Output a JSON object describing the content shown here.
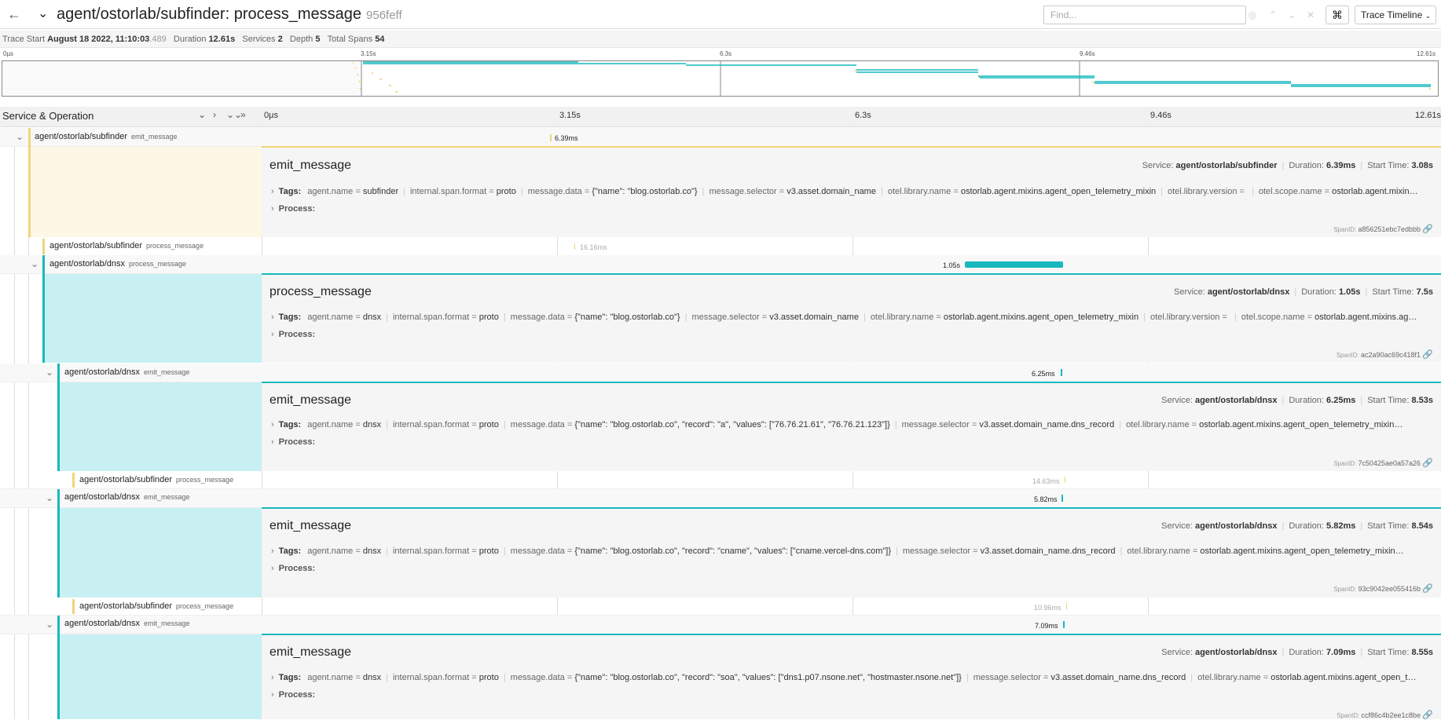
{
  "header": {
    "title": "agent/ostorlab/subfinder: process_message",
    "trace_id": "956feff",
    "find_placeholder": "Find...",
    "view_selector": "Trace Timeline"
  },
  "info": {
    "trace_start_label": "Trace Start",
    "trace_start": "August 18 2022, 11:10:03",
    "trace_start_ms": ".489",
    "duration_label": "Duration",
    "duration": "12.61s",
    "services_label": "Services",
    "services": "2",
    "depth_label": "Depth",
    "depth": "5",
    "spans_label": "Total Spans",
    "spans": "54"
  },
  "minimap": {
    "ticks": [
      "0µs",
      "3.15s",
      "6.3s",
      "9.46s",
      "12.61s"
    ]
  },
  "timeline": {
    "service_operation": "Service & Operation",
    "ticks": [
      "0µs",
      "3.15s",
      "6.3s",
      "9.46s",
      "12.61s"
    ]
  },
  "colors": {
    "subfinder": "#f0d47a",
    "dnsx": "#17b8be",
    "subfinder_bg": "#fdf8e6",
    "dnsx_bg": "#c8f0f2"
  },
  "labels": {
    "tags": "Tags:",
    "process": "Process:",
    "service": "Service:",
    "duration": "Duration:",
    "start_time": "Start Time:",
    "span_id": "SpanID:"
  },
  "spans": [
    {
      "service": "agent/ostorlab/subfinder",
      "operation": "emit_message",
      "duration": "6.39ms"
    },
    {
      "service": "agent/ostorlab/subfinder",
      "operation": "process_message",
      "duration": "16.16ms"
    },
    {
      "service": "agent/ostorlab/dnsx",
      "operation": "process_message",
      "duration": "1.05s"
    },
    {
      "service": "agent/ostorlab/dnsx",
      "operation": "emit_message",
      "duration": "6.25ms"
    },
    {
      "service": "agent/ostorlab/subfinder",
      "operation": "process_message",
      "duration": "14.63ms"
    },
    {
      "service": "agent/ostorlab/dnsx",
      "operation": "emit_message",
      "duration": "5.82ms"
    },
    {
      "service": "agent/ostorlab/subfinder",
      "operation": "process_message",
      "duration": "10.96ms"
    },
    {
      "service": "agent/ostorlab/dnsx",
      "operation": "emit_message",
      "duration": "7.09ms"
    }
  ],
  "details": [
    {
      "title": "emit_message",
      "service": "agent/ostorlab/subfinder",
      "duration": "6.39ms",
      "start": "3.08s",
      "span_id": "a856251ebc7edbbb",
      "tags": [
        {
          "k": "agent.name",
          "v": "subfinder"
        },
        {
          "k": "internal.span.format",
          "v": "proto"
        },
        {
          "k": "message.data",
          "v": "{\"name\": \"blog.ostorlab.co\"}"
        },
        {
          "k": "message.selector",
          "v": "v3.asset.domain_name"
        },
        {
          "k": "otel.library.name",
          "v": "ostorlab.agent.mixins.agent_open_telemetry_mixin"
        },
        {
          "k": "otel.library.version",
          "v": ""
        },
        {
          "k": "otel.scope.name",
          "v": "ostorlab.agent.mixin…"
        }
      ]
    },
    {
      "title": "process_message",
      "service": "agent/ostorlab/dnsx",
      "duration": "1.05s",
      "start": "7.5s",
      "span_id": "ac2a90ac69c418f1",
      "tags": [
        {
          "k": "agent.name",
          "v": "dnsx"
        },
        {
          "k": "internal.span.format",
          "v": "proto"
        },
        {
          "k": "message.data",
          "v": "{\"name\": \"blog.ostorlab.co\"}"
        },
        {
          "k": "message.selector",
          "v": "v3.asset.domain_name"
        },
        {
          "k": "otel.library.name",
          "v": "ostorlab.agent.mixins.agent_open_telemetry_mixin"
        },
        {
          "k": "otel.library.version",
          "v": ""
        },
        {
          "k": "otel.scope.name",
          "v": "ostorlab.agent.mixins.ag…"
        }
      ]
    },
    {
      "title": "emit_message",
      "service": "agent/ostorlab/dnsx",
      "duration": "6.25ms",
      "start": "8.53s",
      "span_id": "7c50425ae0a57a26",
      "tags": [
        {
          "k": "agent.name",
          "v": "dnsx"
        },
        {
          "k": "internal.span.format",
          "v": "proto"
        },
        {
          "k": "message.data",
          "v": "{\"name\": \"blog.ostorlab.co\", \"record\": \"a\", \"values\": [\"76.76.21.61\", \"76.76.21.123\"]}"
        },
        {
          "k": "message.selector",
          "v": "v3.asset.domain_name.dns_record"
        },
        {
          "k": "otel.library.name",
          "v": "ostorlab.agent.mixins.agent_open_telemetry_mixin…"
        }
      ]
    },
    {
      "title": "emit_message",
      "service": "agent/ostorlab/dnsx",
      "duration": "5.82ms",
      "start": "8.54s",
      "span_id": "93c9042ee055416b",
      "tags": [
        {
          "k": "agent.name",
          "v": "dnsx"
        },
        {
          "k": "internal.span.format",
          "v": "proto"
        },
        {
          "k": "message.data",
          "v": "{\"name\": \"blog.ostorlab.co\", \"record\": \"cname\", \"values\": [\"cname.vercel-dns.com\"]}"
        },
        {
          "k": "message.selector",
          "v": "v3.asset.domain_name.dns_record"
        },
        {
          "k": "otel.library.name",
          "v": "ostorlab.agent.mixins.agent_open_telemetry_mixin…"
        }
      ]
    },
    {
      "title": "emit_message",
      "service": "agent/ostorlab/dnsx",
      "duration": "7.09ms",
      "start": "8.55s",
      "span_id": "ccf86c4b2ee1c8be",
      "tags": [
        {
          "k": "agent.name",
          "v": "dnsx"
        },
        {
          "k": "internal.span.format",
          "v": "proto"
        },
        {
          "k": "message.data",
          "v": "{\"name\": \"blog.ostorlab.co\", \"record\": \"soa\", \"values\": [\"dns1.p07.nsone.net\", \"hostmaster.nsone.net\"]}"
        },
        {
          "k": "message.selector",
          "v": "v3.asset.domain_name.dns_record"
        },
        {
          "k": "otel.library.name",
          "v": "ostorlab.agent.mixins.agent_open_t…"
        }
      ]
    }
  ]
}
